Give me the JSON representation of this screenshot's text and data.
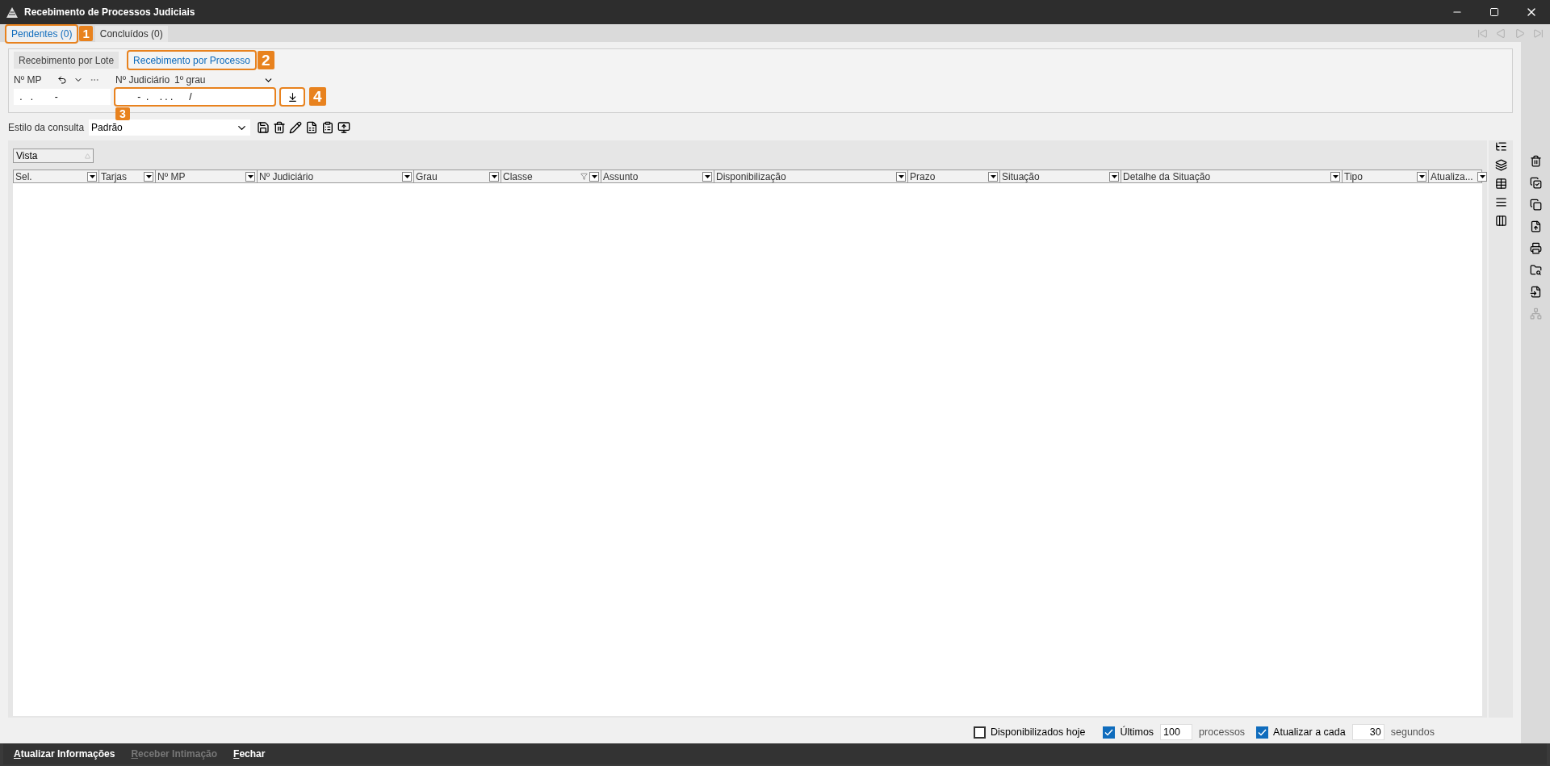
{
  "window": {
    "title": "Recebimento de Processos Judiciais"
  },
  "tabs": [
    {
      "label": "Pendentes (0)",
      "selected": true
    },
    {
      "label": "Concluídos (0)",
      "selected": false
    }
  ],
  "subtabs": [
    {
      "label": "Recebimento por Lote",
      "selected": false
    },
    {
      "label": "Recebimento por Processo",
      "selected": true
    }
  ],
  "mp_field": {
    "label": "Nº MP",
    "value": " .   .        -"
  },
  "judicial_field": {
    "label": "Nº Judiciário",
    "grade": "1º grau",
    "value": "       -  .    . . .      /"
  },
  "query_style": {
    "label": "Estilo da consulta",
    "value": "Padrão"
  },
  "view_sort": {
    "label": "Vista"
  },
  "columns": [
    {
      "label": "Sel.",
      "filtered": false
    },
    {
      "label": "Tarjas",
      "filtered": false
    },
    {
      "label": "Nº MP",
      "filtered": false
    },
    {
      "label": "Nº Judiciário",
      "filtered": false
    },
    {
      "label": "Grau",
      "filtered": false
    },
    {
      "label": "Classe",
      "filtered": true
    },
    {
      "label": "Assunto",
      "filtered": false
    },
    {
      "label": "Disponibilização",
      "filtered": false
    },
    {
      "label": "Prazo",
      "filtered": false
    },
    {
      "label": "Situação",
      "filtered": false
    },
    {
      "label": "Detalhe da Situação",
      "filtered": false
    },
    {
      "label": "Tipo",
      "filtered": false
    },
    {
      "label": "Atualiza...",
      "filtered": false
    }
  ],
  "filters": {
    "today": {
      "label": "Disponibilizados hoje",
      "checked": false
    },
    "last": {
      "label": "Últimos",
      "checked": true,
      "value": "100",
      "unit": "processos"
    },
    "refresh": {
      "label": "Atualizar a cada",
      "checked": true,
      "value": "30",
      "unit": "segundos"
    }
  },
  "footer_buttons": [
    {
      "label": "Atualizar Informações",
      "disabled": false
    },
    {
      "label": "Receber Intimação",
      "disabled": true
    },
    {
      "label": "Fechar",
      "disabled": false
    }
  ],
  "callouts": [
    {
      "number": "1"
    },
    {
      "number": "2"
    },
    {
      "number": "3"
    },
    {
      "number": "4"
    }
  ]
}
